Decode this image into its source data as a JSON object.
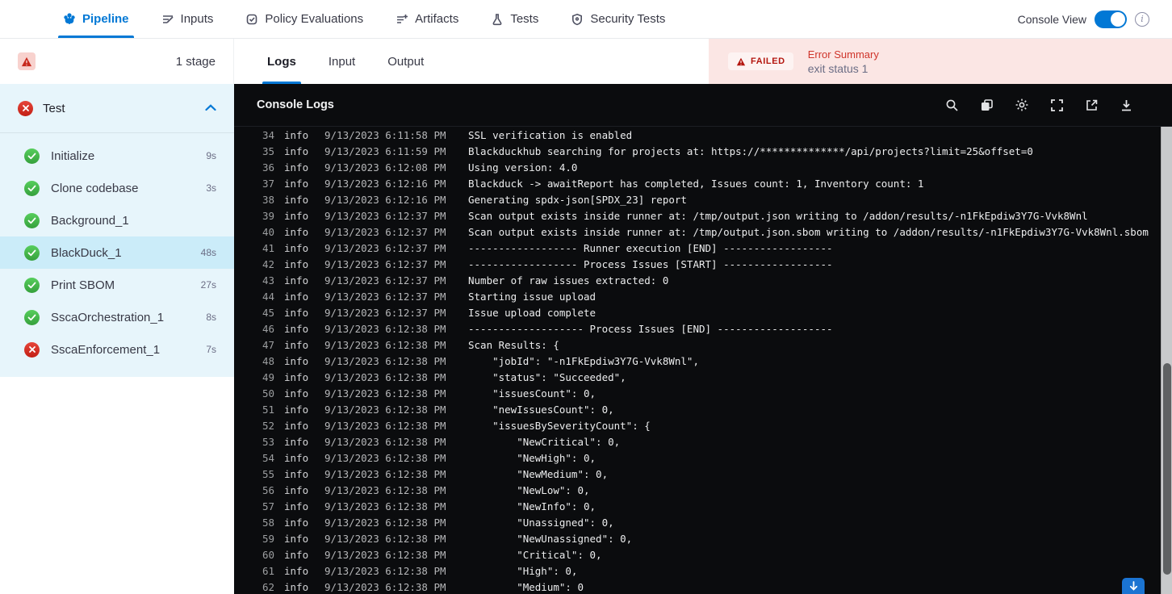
{
  "topnav": {
    "items": [
      {
        "label": "Pipeline",
        "icon": "pipeline-icon",
        "active": true
      },
      {
        "label": "Inputs",
        "icon": "inputs-icon",
        "active": false
      },
      {
        "label": "Policy Evaluations",
        "icon": "policy-evaluations-icon",
        "active": false
      },
      {
        "label": "Artifacts",
        "icon": "artifacts-icon",
        "active": false
      },
      {
        "label": "Tests",
        "icon": "tests-icon",
        "active": false
      },
      {
        "label": "Security Tests",
        "icon": "security-tests-icon",
        "active": false
      }
    ],
    "console_view_label": "Console View",
    "console_view_on": true
  },
  "sidebar": {
    "stage_count_label": "1 stage",
    "stage": {
      "name": "Test",
      "status": "failed"
    },
    "steps": [
      {
        "label": "Initialize",
        "duration": "9s",
        "status": "success",
        "selected": false
      },
      {
        "label": "Clone codebase",
        "duration": "3s",
        "status": "success",
        "selected": false
      },
      {
        "label": "Background_1",
        "duration": "",
        "status": "success",
        "selected": false
      },
      {
        "label": "BlackDuck_1",
        "duration": "48s",
        "status": "success",
        "selected": true
      },
      {
        "label": "Print SBOM",
        "duration": "27s",
        "status": "success",
        "selected": false
      },
      {
        "label": "SscaOrchestration_1",
        "duration": "8s",
        "status": "success",
        "selected": false
      },
      {
        "label": "SscaEnforcement_1",
        "duration": "7s",
        "status": "failed",
        "selected": false
      }
    ]
  },
  "main": {
    "tabs": [
      {
        "label": "Logs",
        "active": true
      },
      {
        "label": "Input",
        "active": false
      },
      {
        "label": "Output",
        "active": false
      }
    ],
    "error_summary": {
      "badge": "FAILED",
      "title": "Error Summary",
      "message": "exit status 1"
    },
    "console": {
      "title": "Console Logs",
      "toolbar_icons": [
        "search-icon",
        "copy-icon",
        "settings-icon",
        "fullscreen-icon",
        "open-in-new-icon",
        "download-icon"
      ],
      "logs": [
        {
          "n": 34,
          "level": "info",
          "ts": "9/13/2023 6:11:58 PM",
          "msg": "SSL verification is enabled"
        },
        {
          "n": 35,
          "level": "info",
          "ts": "9/13/2023 6:11:59 PM",
          "msg": "Blackduckhub searching for projects at: https://**************/api/projects?limit=25&offset=0"
        },
        {
          "n": 36,
          "level": "info",
          "ts": "9/13/2023 6:12:08 PM",
          "msg": "Using version: 4.0"
        },
        {
          "n": 37,
          "level": "info",
          "ts": "9/13/2023 6:12:16 PM",
          "msg": "Blackduck -> awaitReport has completed, Issues count: 1, Inventory count: 1"
        },
        {
          "n": 38,
          "level": "info",
          "ts": "9/13/2023 6:12:16 PM",
          "msg": "Generating spdx-json[SPDX_23] report"
        },
        {
          "n": 39,
          "level": "info",
          "ts": "9/13/2023 6:12:37 PM",
          "msg": "Scan output exists inside runner at: /tmp/output.json writing to /addon/results/-n1FkEpdiw3Y7G-Vvk8Wnl"
        },
        {
          "n": 40,
          "level": "info",
          "ts": "9/13/2023 6:12:37 PM",
          "msg": "Scan output exists inside runner at: /tmp/output.json.sbom writing to /addon/results/-n1FkEpdiw3Y7G-Vvk8Wnl.sbom"
        },
        {
          "n": 41,
          "level": "info",
          "ts": "9/13/2023 6:12:37 PM",
          "msg": "------------------ Runner execution [END] ------------------"
        },
        {
          "n": 42,
          "level": "info",
          "ts": "9/13/2023 6:12:37 PM",
          "msg": "------------------ Process Issues [START] ------------------"
        },
        {
          "n": 43,
          "level": "info",
          "ts": "9/13/2023 6:12:37 PM",
          "msg": "Number of raw issues extracted: 0"
        },
        {
          "n": 44,
          "level": "info",
          "ts": "9/13/2023 6:12:37 PM",
          "msg": "Starting issue upload"
        },
        {
          "n": 45,
          "level": "info",
          "ts": "9/13/2023 6:12:37 PM",
          "msg": "Issue upload complete"
        },
        {
          "n": 46,
          "level": "info",
          "ts": "9/13/2023 6:12:38 PM",
          "msg": "------------------- Process Issues [END] -------------------"
        },
        {
          "n": 47,
          "level": "info",
          "ts": "9/13/2023 6:12:38 PM",
          "msg": "Scan Results: {"
        },
        {
          "n": 48,
          "level": "info",
          "ts": "9/13/2023 6:12:38 PM",
          "msg": "    \"jobId\": \"-n1FkEpdiw3Y7G-Vvk8Wnl\","
        },
        {
          "n": 49,
          "level": "info",
          "ts": "9/13/2023 6:12:38 PM",
          "msg": "    \"status\": \"Succeeded\","
        },
        {
          "n": 50,
          "level": "info",
          "ts": "9/13/2023 6:12:38 PM",
          "msg": "    \"issuesCount\": 0,"
        },
        {
          "n": 51,
          "level": "info",
          "ts": "9/13/2023 6:12:38 PM",
          "msg": "    \"newIssuesCount\": 0,"
        },
        {
          "n": 52,
          "level": "info",
          "ts": "9/13/2023 6:12:38 PM",
          "msg": "    \"issuesBySeverityCount\": {"
        },
        {
          "n": 53,
          "level": "info",
          "ts": "9/13/2023 6:12:38 PM",
          "msg": "        \"NewCritical\": 0,"
        },
        {
          "n": 54,
          "level": "info",
          "ts": "9/13/2023 6:12:38 PM",
          "msg": "        \"NewHigh\": 0,"
        },
        {
          "n": 55,
          "level": "info",
          "ts": "9/13/2023 6:12:38 PM",
          "msg": "        \"NewMedium\": 0,"
        },
        {
          "n": 56,
          "level": "info",
          "ts": "9/13/2023 6:12:38 PM",
          "msg": "        \"NewLow\": 0,"
        },
        {
          "n": 57,
          "level": "info",
          "ts": "9/13/2023 6:12:38 PM",
          "msg": "        \"NewInfo\": 0,"
        },
        {
          "n": 58,
          "level": "info",
          "ts": "9/13/2023 6:12:38 PM",
          "msg": "        \"Unassigned\": 0,"
        },
        {
          "n": 59,
          "level": "info",
          "ts": "9/13/2023 6:12:38 PM",
          "msg": "        \"NewUnassigned\": 0,"
        },
        {
          "n": 60,
          "level": "info",
          "ts": "9/13/2023 6:12:38 PM",
          "msg": "        \"Critical\": 0,"
        },
        {
          "n": 61,
          "level": "info",
          "ts": "9/13/2023 6:12:38 PM",
          "msg": "        \"High\": 0,"
        },
        {
          "n": 62,
          "level": "info",
          "ts": "9/13/2023 6:12:38 PM",
          "msg": "        \"Medium\": 0"
        }
      ]
    }
  },
  "colors": {
    "accent_blue": "#0278d5",
    "error_red": "#b41710",
    "error_bg": "#fbe6e4",
    "success_green": "#3fae46",
    "sidebar_bg": "#e7f5fb",
    "selected_step_bg": "#cbecf9",
    "console_bg": "#0b0c0e"
  }
}
